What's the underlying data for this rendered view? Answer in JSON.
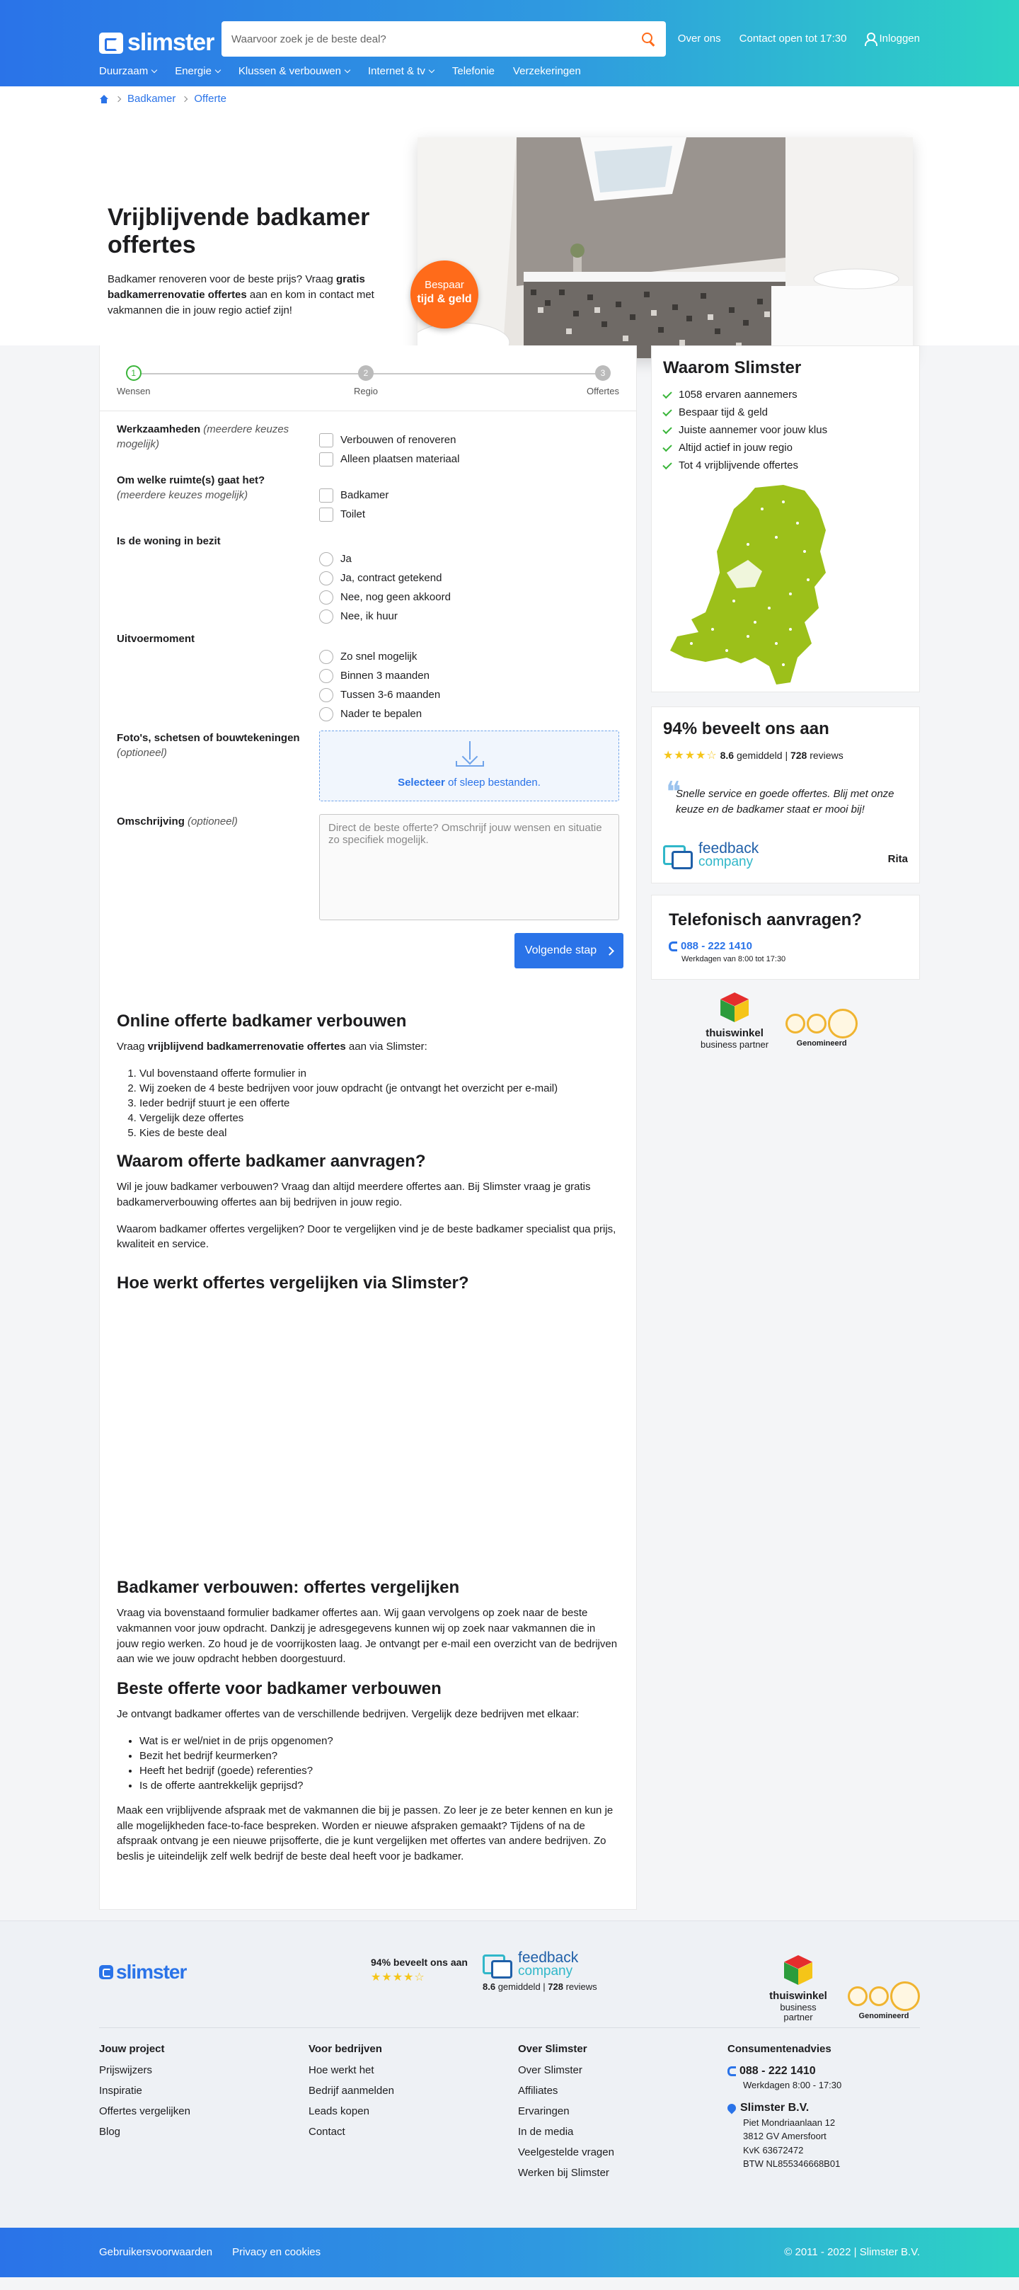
{
  "header": {
    "logo_text": "slimster",
    "search_placeholder": "Waarvoor zoek je de beste deal?",
    "links": [
      "Over ons",
      "Contact open tot 17:30",
      "Inloggen"
    ],
    "nav": [
      {
        "label": "Duurzaam",
        "dropdown": true
      },
      {
        "label": "Energie",
        "dropdown": true
      },
      {
        "label": "Klussen & verbouwen",
        "dropdown": true
      },
      {
        "label": "Internet & tv",
        "dropdown": true
      },
      {
        "label": "Telefonie",
        "dropdown": false
      },
      {
        "label": "Verzekeringen",
        "dropdown": false
      }
    ]
  },
  "breadcrumb": [
    "Badkamer",
    "Offerte"
  ],
  "hero": {
    "title": "Vrijblijvende badkamer offertes",
    "intro_1": "Badkamer renoveren voor de beste prijs? Vraag ",
    "intro_bold": "gratis badkamerrenovatie offertes",
    "intro_2": " aan en kom in contact met vakmannen die in jouw regio actief zijn!",
    "badge_line1": "Bespaar",
    "badge_line2": "tijd & geld"
  },
  "stepper": {
    "steps": [
      {
        "num": "1",
        "label": "Wensen"
      },
      {
        "num": "2",
        "label": "Regio"
      },
      {
        "num": "3",
        "label": "Offertes"
      }
    ]
  },
  "form": {
    "q1": {
      "label": "Werkzaamheden",
      "hint": "(meerdere keuzes mogelijk)",
      "options": [
        "Verbouwen of renoveren",
        "Alleen plaatsen materiaal"
      ]
    },
    "q2": {
      "label": "Om welke ruimte(s) gaat het?",
      "hint": "(meerdere keuzes mogelijk)",
      "options": [
        "Badkamer",
        "Toilet"
      ]
    },
    "q3": {
      "label": "Is de woning in bezit",
      "options": [
        "Ja",
        "Ja, contract getekend",
        "Nee, nog geen akkoord",
        "Nee, ik huur"
      ]
    },
    "q4": {
      "label": "Uitvoermoment",
      "options": [
        "Zo snel mogelijk",
        "Binnen 3 maanden",
        "Tussen 3-6 maanden",
        "Nader te bepalen"
      ]
    },
    "upload": {
      "label": "Foto's, schetsen of bouwtekeningen",
      "hint": "(optioneel)",
      "link": "Selecteer",
      "text": " of sleep bestanden."
    },
    "description": {
      "label": "Omschrijving",
      "hint": "(optioneel)",
      "placeholder": "Direct de beste offerte? Omschrijf jouw wensen en situatie zo specifiek mogelijk."
    },
    "next_label": "Volgende stap"
  },
  "content": {
    "s1_title": "Online offerte badkamer verbouwen",
    "s1_intro_1": "Vraag ",
    "s1_intro_bold": "vrijblijvend badkamerrenovatie offertes",
    "s1_intro_2": " aan via Slimster:",
    "s1_steps": [
      "Vul bovenstaand offerte formulier in",
      "Wij zoeken de 4 beste bedrijven voor jouw opdracht (je ontvangt het overzicht per e-mail)",
      "Ieder bedrijf stuurt je een offerte",
      "Vergelijk deze offertes",
      "Kies de beste deal"
    ],
    "s2_title": "Waarom offerte badkamer aanvragen?",
    "s2_p1": "Wil je jouw badkamer verbouwen? Vraag dan altijd meerdere offertes aan. Bij Slimster vraag je gratis badkamerverbouwing offertes aan bij bedrijven in jouw regio.",
    "s2_p2": "Waarom badkamer offertes vergelijken? Door te vergelijken vind je de beste badkamer specialist qua prijs, kwaliteit en service.",
    "s3_title": "Hoe werkt offertes vergelijken via Slimster?",
    "s4_title": "Badkamer verbouwen: offertes vergelijken",
    "s4_p1": "Vraag via bovenstaand formulier badkamer offertes aan. Wij gaan vervolgens op zoek naar de beste vakmannen voor jouw opdracht. Dankzij je adresgegevens kunnen wij op zoek naar vakmannen die in jouw regio werken. Zo houd je de voorrijkosten laag. Je ontvangt per e-mail een overzicht van de bedrijven aan wie we jouw opdracht hebben doorgestuurd.",
    "s5_title": "Beste offerte voor badkamer verbouwen",
    "s5_p1": "Je ontvangt badkamer offertes van de verschillende bedrijven. Vergelijk deze bedrijven met elkaar:",
    "s5_list": [
      "Wat is er wel/niet in de prijs opgenomen?",
      "Bezit het bedrijf keurmerken?",
      "Heeft het bedrijf (goede) referenties?",
      "Is de offerte aantrekkelijk geprijsd?"
    ],
    "s5_p2": "Maak een vrijblijvende afspraak met de vakmannen die bij je passen. Zo leer je ze beter kennen en kun je alle mogelijkheden face-to-face bespreken. Worden er nieuwe afspraken gemaakt? Tijdens of na de afspraak ontvang je een nieuwe prijsofferte, die je kunt vergelijken met offertes van andere bedrijven. Zo beslis je uiteindelijk zelf welk bedrijf de beste deal heeft voor je badkamer."
  },
  "sidebar": {
    "why_title": "Waarom Slimster",
    "why_items": [
      "1058 ervaren aannemers",
      "Bespaar tijd & geld",
      "Juiste aannemer voor jouw klus",
      "Altijd actief in jouw regio",
      "Tot 4 vrijblijvende offertes"
    ],
    "review_title": "94% beveelt ons aan",
    "score": "8.6",
    "score_text": " gemiddeld | ",
    "review_count": "728",
    "reviews_word": " reviews",
    "quote": "Snelle service en goede offertes. Blij met onze keuze en de badkamer staat er mooi bij!",
    "reviewer": "Rita",
    "fb_line1": "feedback",
    "fb_line2": "company",
    "phone_title": "Telefonisch aanvragen?",
    "phone": "088 - 222 1410",
    "phone_hours": "Werkdagen van 8:00 tot 17:30",
    "tw_line1": "thuiswinkel",
    "tw_line2": "business partner",
    "genom": "Genomineerd"
  },
  "footer": {
    "logo_text": "slimster",
    "recommend": "94% beveelt ons aan",
    "score": "8.6",
    "score_text": " gemiddeld | ",
    "review_count": "728",
    "reviews_word": " reviews",
    "fb_line1": "feedback",
    "fb_line2": "company",
    "tw_line1": "thuiswinkel",
    "tw_line2": "business partner",
    "genom": "Genomineerd",
    "col1": {
      "title": "Jouw project",
      "items": [
        "Prijswijzers",
        "Inspiratie",
        "Offertes vergelijken",
        "Blog"
      ]
    },
    "col2": {
      "title": "Voor bedrijven",
      "items": [
        "Hoe werkt het",
        "Bedrijf aanmelden",
        "Leads kopen",
        "Contact"
      ]
    },
    "col3": {
      "title": "Over Slimster",
      "items": [
        "Over Slimster",
        "Affiliates",
        "Ervaringen",
        "In de media",
        "Veelgestelde vragen",
        "Werken bij Slimster"
      ]
    },
    "col4": {
      "title": "Consumentenadvies",
      "phone": "088 - 222 1410",
      "hours": "Werkdagen 8:00 - 17:30",
      "company": "Slimster B.V.",
      "address": [
        "Piet Mondriaanlaan 12",
        "3812 GV Amersfoort",
        "KvK 63672472",
        "BTW NL855346668B01"
      ]
    },
    "bottom_links": [
      "Gebruikersvoorwaarden",
      "Privacy en cookies"
    ],
    "copyright": "© 2011 - 2022 | Slimster B.V."
  },
  "colors": {
    "brand_blue": "#2a73e8",
    "accent_orange": "#ff6b1a",
    "check_green": "#3ab53a",
    "map_green": "#9cc01a"
  }
}
